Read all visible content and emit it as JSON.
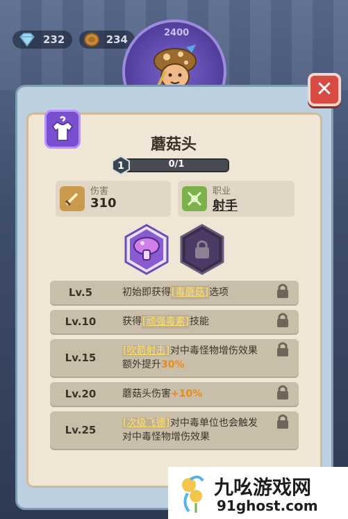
{
  "currency": {
    "gems": "232",
    "coins": "234",
    "ring_top": "2400"
  },
  "hero": {
    "name": "蘑菇头",
    "level": "1",
    "progress_text": "0/1",
    "progress": 0
  },
  "stats": {
    "damage_label": "伤害",
    "damage_value": "310",
    "class_label": "职业",
    "class_value": "射手"
  },
  "skills": [
    {
      "icon": "mushroom-skill-icon",
      "locked": false
    },
    {
      "icon": "locked-skill-icon",
      "locked": true
    }
  ],
  "levels": [
    {
      "lv": "Lv.5",
      "pre": "初始即获得",
      "hl": "[毒蘑菇]",
      "post": "选项",
      "line2": "",
      "pct": ""
    },
    {
      "lv": "Lv.10",
      "pre": "获得 ",
      "hl": "[顽强毒素]",
      "post": " 技能",
      "line2": "",
      "pct": ""
    },
    {
      "lv": "Lv.15",
      "pre": "",
      "hl": "[吹箭射击]",
      "post": "对中毒怪物增伤效果",
      "line2": "额外提升",
      "pct": "30%"
    },
    {
      "lv": "Lv.20",
      "pre": "蘑菇头伤害",
      "hl": "",
      "post": "",
      "line2": "",
      "pct": "+10%"
    },
    {
      "lv": "Lv.25",
      "pre": "",
      "hl": "[次级飞镖]",
      "post": "对中毒单位也会触发",
      "line2": "对中毒怪物增伤效果",
      "pct": ""
    }
  ],
  "watermark": {
    "title": "九吆游戏网",
    "url": "91ghost.com"
  },
  "colors": {
    "panel": "#efe6d6",
    "row": "#c9bea9",
    "highlight": "#ffe169",
    "percent": "#e98a16",
    "close": "#d84a44",
    "class_badge": "#7a4fcf"
  }
}
